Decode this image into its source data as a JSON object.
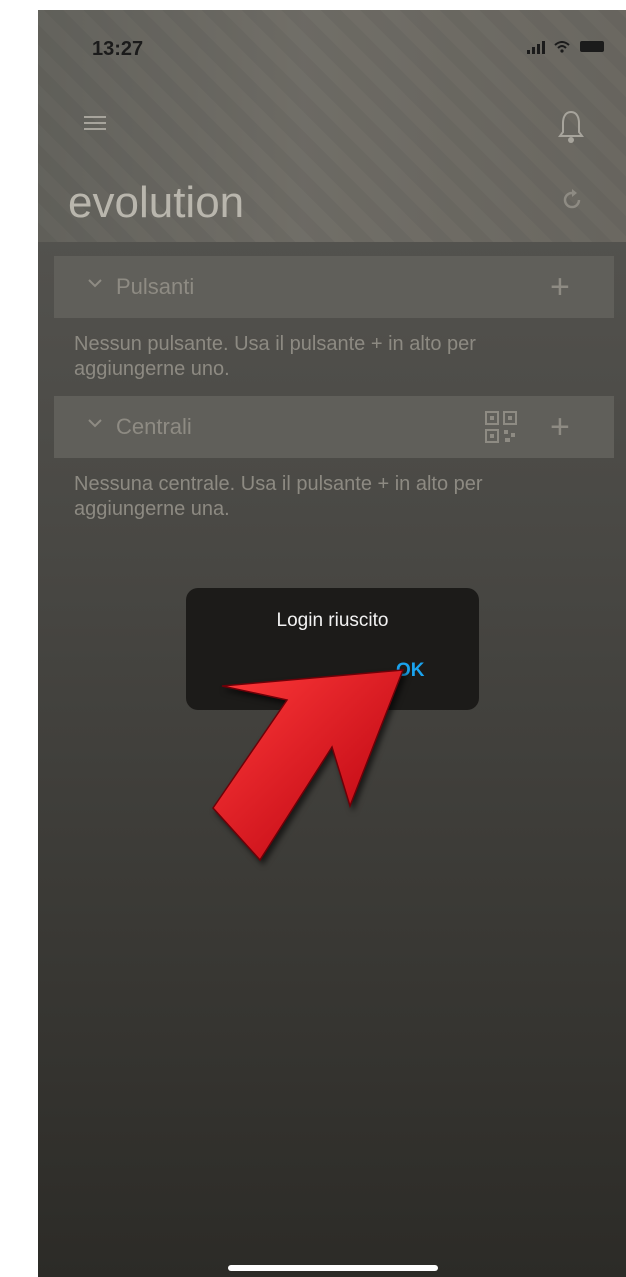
{
  "status_bar": {
    "time": "13:27"
  },
  "header": {
    "title": "evolution"
  },
  "sections": [
    {
      "label": "Pulsanti",
      "empty_message_line1": "Nessun pulsante. Usa il pulsante + in alto per",
      "empty_message_line2": "aggiungerne uno.",
      "add_label": "+"
    },
    {
      "label": "Centrali",
      "empty_message_line1": "Nessuna centrale. Usa il pulsante + in alto per",
      "empty_message_line2": "aggiungerne una.",
      "add_label": "+"
    }
  ],
  "dialog": {
    "message": "Login riuscito",
    "ok_label": "OK"
  },
  "colors": {
    "accent": "#1aa3ee",
    "arrow": "#e2101c",
    "dialog_bg": "#1c1b19"
  },
  "icons": [
    "menu-icon",
    "bell-icon",
    "refresh-icon",
    "chevron-down-icon",
    "qr-code-icon",
    "plus-icon",
    "arrow-pointer"
  ]
}
